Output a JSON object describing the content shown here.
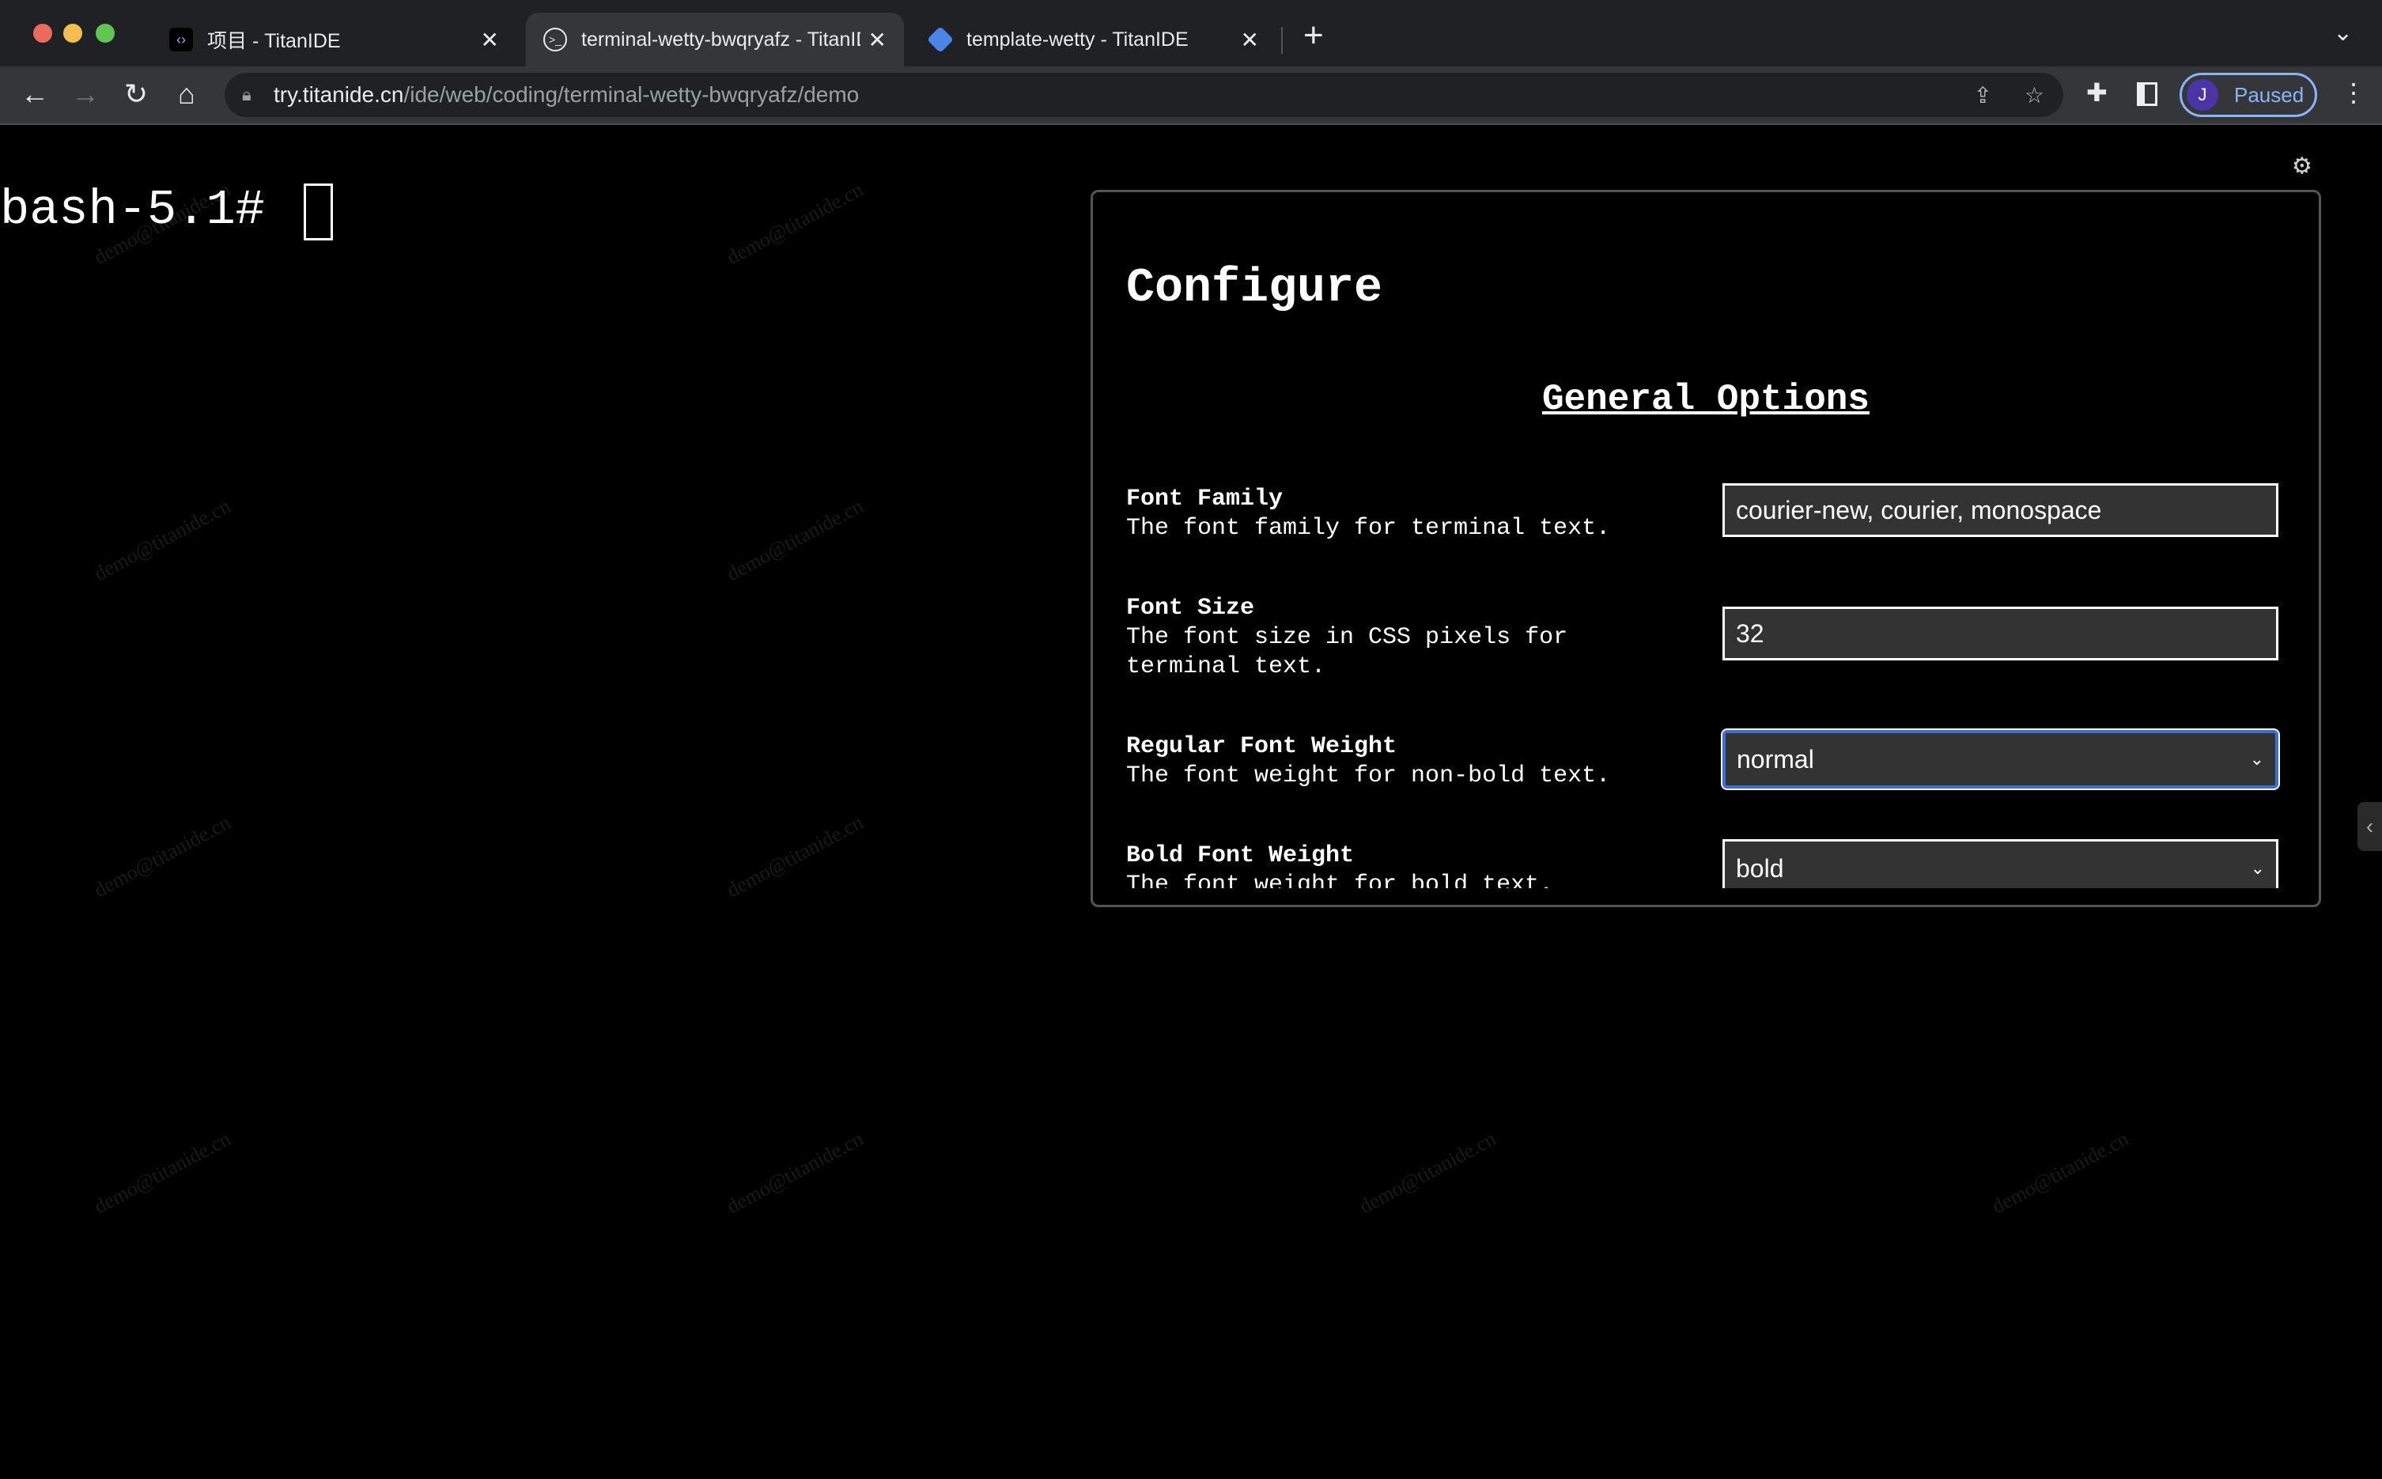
{
  "browser": {
    "tabs": [
      {
        "title": "项目 - TitanIDE",
        "icon": "code-icon",
        "active": false
      },
      {
        "title": "terminal-wetty-bwqryafz - TitanIDE",
        "icon": "terminal-icon",
        "active": true
      },
      {
        "title": "template-wetty - TitanIDE",
        "icon": "layers-icon",
        "active": false
      }
    ],
    "url_host": "try.titanide.cn",
    "url_path": "/ide/web/coding/terminal-wetty-bwqryafz/demo",
    "profile_initial": "J",
    "profile_status": "Paused"
  },
  "terminal": {
    "prompt": "bash-5.1#",
    "watermark": "demo@titanide.cn"
  },
  "config": {
    "title": "Configure",
    "section": "General Options",
    "options": [
      {
        "label": "Font Family",
        "desc": "The font family for terminal text.",
        "value": "courier-new, courier, monospace",
        "type": "text"
      },
      {
        "label": "Font Size",
        "desc": "The font size in CSS pixels for terminal text.",
        "value": "32",
        "type": "text"
      },
      {
        "label": "Regular Font Weight",
        "desc": "The font weight for non-bold text.",
        "value": "normal",
        "type": "select"
      },
      {
        "label": "Bold Font Weight",
        "desc": "The font weight for bold text.",
        "value": "bold",
        "type": "select"
      }
    ]
  },
  "colors": {
    "accent": "#3b6fd6",
    "profile": "#8ab4f8"
  }
}
